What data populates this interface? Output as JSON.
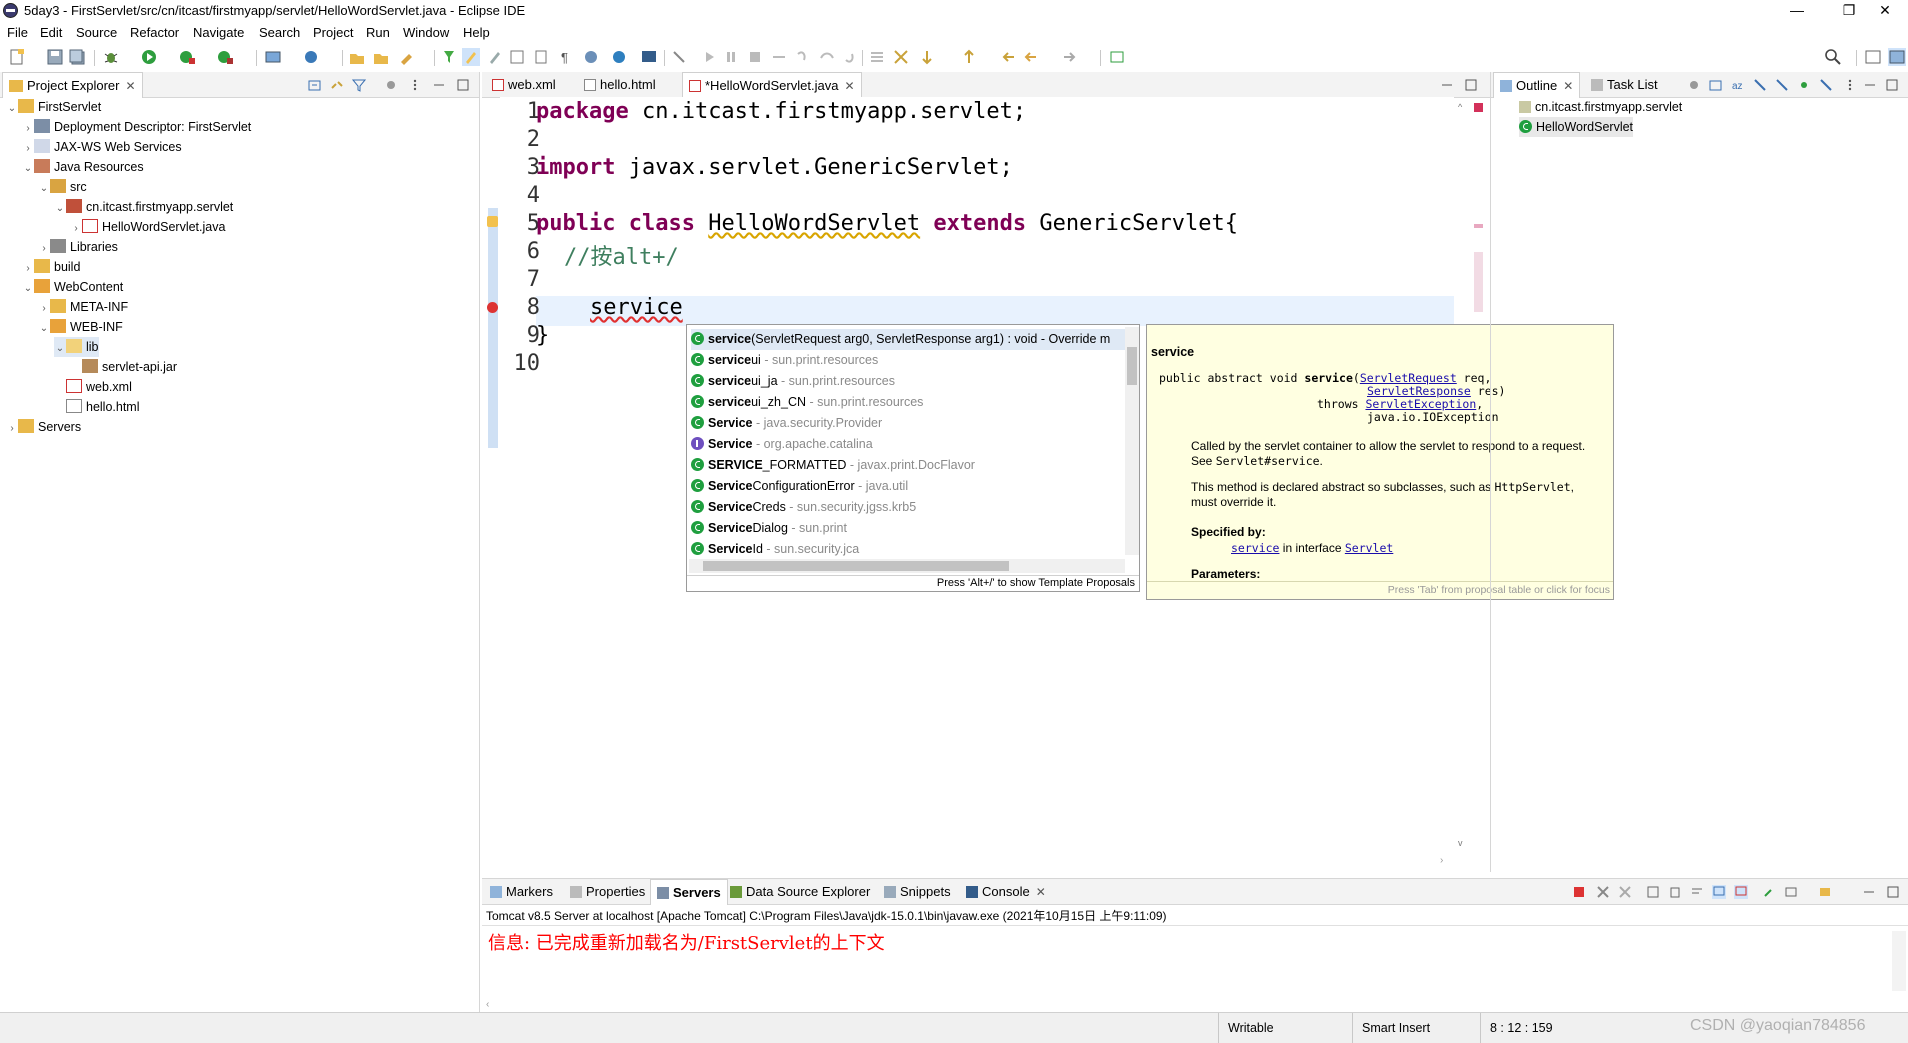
{
  "window": {
    "title": "5day3 - FirstServlet/src/cn/itcast/firstmyapp/servlet/HelloWordServlet.java - Eclipse IDE",
    "minimize": "—",
    "restore": "❐",
    "close": "✕"
  },
  "menu": [
    "File",
    "Edit",
    "Source",
    "Refactor",
    "Navigate",
    "Search",
    "Project",
    "Run",
    "Window",
    "Help"
  ],
  "project_explorer": {
    "title": "Project Explorer",
    "close": "✕",
    "tree": [
      {
        "label": "FirstServlet",
        "arrow": "⌄",
        "icon": "project"
      },
      {
        "label": "Deployment Descriptor: FirstServlet",
        "arrow": "›",
        "icon": "descriptor"
      },
      {
        "label": "JAX-WS Web Services",
        "arrow": "›",
        "icon": "webservices"
      },
      {
        "label": "Java Resources",
        "arrow": "⌄",
        "icon": "javares"
      },
      {
        "label": "src",
        "arrow": "⌄",
        "icon": "srcfolder"
      },
      {
        "label": "cn.itcast.firstmyapp.servlet",
        "arrow": "⌄",
        "icon": "package"
      },
      {
        "label": "HelloWordServlet.java",
        "arrow": "›",
        "icon": "javafile"
      },
      {
        "label": "Libraries",
        "arrow": "›",
        "icon": "library"
      },
      {
        "label": "build",
        "arrow": "›",
        "icon": "folder"
      },
      {
        "label": "WebContent",
        "arrow": "⌄",
        "icon": "folder"
      },
      {
        "label": "META-INF",
        "arrow": "›",
        "icon": "folder"
      },
      {
        "label": "WEB-INF",
        "arrow": "⌄",
        "icon": "folder"
      },
      {
        "label": "lib",
        "arrow": "⌄",
        "icon": "folder-open"
      },
      {
        "label": "servlet-api.jar",
        "arrow": "",
        "icon": "jar"
      },
      {
        "label": "web.xml",
        "arrow": "",
        "icon": "xml"
      },
      {
        "label": "hello.html",
        "arrow": "",
        "icon": "html"
      },
      {
        "label": "Servers",
        "arrow": "›",
        "icon": "servers"
      }
    ]
  },
  "editor": {
    "tabs": [
      {
        "label": "web.xml",
        "active": false
      },
      {
        "label": "hello.html",
        "active": false
      },
      {
        "label": "*HelloWordServlet.java",
        "active": true
      }
    ],
    "tab_close": "✕",
    "line_numbers": [
      "1",
      "2",
      "3",
      "4",
      "5",
      "6",
      "7",
      "8",
      "9",
      "10"
    ],
    "lines": {
      "l1_kw": "package",
      "l1_rest": " cn.itcast.firstmyapp.servlet;",
      "l3_kw": "import",
      "l3_rest": " javax.servlet.GenericServlet;",
      "l5_kw1": "public",
      "l5_kw2": "class",
      "l5_name": "HelloWordServlet",
      "l5_kw3": "extends",
      "l5_rest": " GenericServlet{",
      "l6_comment": "//按alt+/",
      "l8_text": "service",
      "l9_text": "}"
    }
  },
  "proposals": {
    "items": [
      {
        "bold": "service",
        "rest": "(ServletRequest arg0, ServletResponse arg1) : void - Override m",
        "qual": "",
        "kind": "method"
      },
      {
        "bold": "service",
        "rest": "ui",
        "qual": " - sun.print.resources",
        "kind": "class"
      },
      {
        "bold": "service",
        "rest": "ui_ja",
        "qual": " - sun.print.resources",
        "kind": "class"
      },
      {
        "bold": "service",
        "rest": "ui_zh_CN",
        "qual": " - sun.print.resources",
        "kind": "class"
      },
      {
        "bold": "Service",
        "rest": "",
        "qual": " - java.security.Provider",
        "kind": "class"
      },
      {
        "bold": "Service",
        "rest": "",
        "qual": " - org.apache.catalina",
        "kind": "iface"
      },
      {
        "bold": "SERVICE",
        "rest": "_FORMATTED",
        "qual": " - javax.print.DocFlavor",
        "kind": "class"
      },
      {
        "bold": "Service",
        "rest": "ConfigurationError",
        "qual": " - java.util",
        "kind": "class"
      },
      {
        "bold": "Service",
        "rest": "Creds",
        "qual": " - sun.security.jgss.krb5",
        "kind": "class"
      },
      {
        "bold": "Service",
        "rest": "Dialog",
        "qual": " - sun.print",
        "kind": "class"
      },
      {
        "bold": "Service",
        "rest": "Id",
        "qual": " - sun.security.jca",
        "kind": "class"
      }
    ],
    "footer": "Press 'Alt+/' to show Template Proposals"
  },
  "doc": {
    "heading": "service",
    "sig_prefix": "public abstract void ",
    "sig_method": "service",
    "sig_p1_type": "ServletRequest",
    "sig_p1_name": " req,",
    "sig_p2_type": "ServletResponse",
    "sig_p2_name": " res)",
    "throws": "throws ",
    "ex1": "ServletException",
    "ex1_tail": ",",
    "ex2": "java.io.IOException",
    "desc1_a": "Called by the servlet container to allow the servlet to respond to a request. See ",
    "desc1_code": "Servlet#service",
    "desc1_b": ".",
    "desc2_a": "This method is declared abstract so subclasses, such as ",
    "desc2_code": "HttpServlet",
    "desc2_b": ", must override it.",
    "specified_by": "Specified by:",
    "spec_link": "service",
    "spec_mid": " in interface ",
    "spec_iface": "Servlet",
    "params": "Parameters:",
    "footer": "Press 'Tab' from proposal table or click for focus"
  },
  "outline": {
    "tab1": "Outline",
    "tab2": "Task List",
    "items": [
      "cn.itcast.firstmyapp.servlet",
      "HelloWordServlet"
    ]
  },
  "bottom": {
    "tabs": [
      "Markers",
      "Properties",
      "Servers",
      "Data Source Explorer",
      "Snippets",
      "Console"
    ],
    "server_line": "Tomcat v8.5 Server at localhost [Apache Tomcat] C:\\Program Files\\Java\\jdk-15.0.1\\bin\\javaw.exe  (2021年10月15日 上午9:11:09)",
    "console_text": "信息: 已完成重新加载名为/FirstServlet的上下文"
  },
  "status": {
    "writable": "Writable",
    "insert": "Smart Insert",
    "position": "8 : 12 : 159",
    "watermark": "CSDN @yaoqian784856"
  },
  "colors": {
    "keyword": "#7f0055",
    "comment": "#3f7f5f",
    "console": "#ff0000",
    "link": "#1a0dab",
    "doc_bg": "#ffffe1",
    "current_line": "#e8f2fe"
  }
}
